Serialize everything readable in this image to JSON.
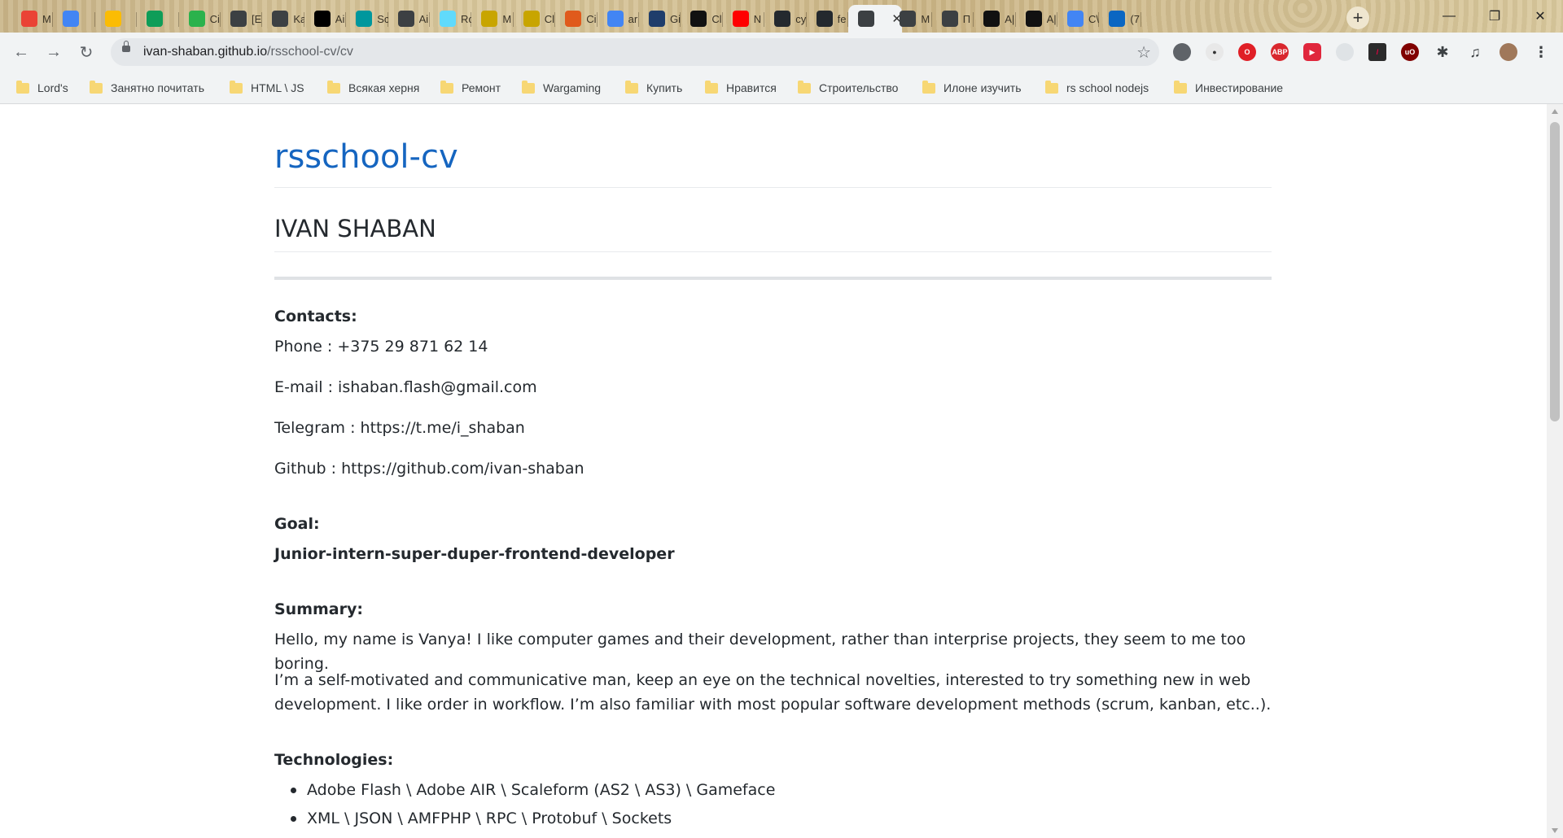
{
  "browser": {
    "tabs": [
      {
        "title": "M",
        "icon": "gmail-icon",
        "color": "#ea4335"
      },
      {
        "title": "",
        "icon": "google-translate-icon",
        "color": "#4285f4"
      },
      {
        "title": "",
        "icon": "google-keep-icon",
        "color": "#fbbc04"
      },
      {
        "title": "",
        "icon": "google-sheets-add-icon",
        "color": "#0f9d58"
      },
      {
        "title": "Ci",
        "icon": "feedly-icon",
        "color": "#2bb24c"
      },
      {
        "title": "[E",
        "icon": "globe-icon",
        "color": "#3c4043"
      },
      {
        "title": "Ka",
        "icon": "globe-icon",
        "color": "#3c4043"
      },
      {
        "title": "Ai",
        "icon": "jetbrains-icon",
        "color": "#000000"
      },
      {
        "title": "Sc",
        "icon": "arduino-icon",
        "color": "#00979d"
      },
      {
        "title": "Ai",
        "icon": "globe-icon",
        "color": "#3c4043"
      },
      {
        "title": "Rc",
        "icon": "react-icon",
        "color": "#61dafb"
      },
      {
        "title": "M",
        "icon": "metamask-icon",
        "color": "#c8a500"
      },
      {
        "title": "Cl",
        "icon": "metamask-icon",
        "color": "#c8a500"
      },
      {
        "title": "Ci",
        "icon": "codepen-icon",
        "color": "#e05a1c"
      },
      {
        "title": "ar",
        "icon": "google-icon",
        "color": "#4285f4"
      },
      {
        "title": "Gi",
        "icon": "r-icon",
        "color": "#1f3d6b"
      },
      {
        "title": "Cl",
        "icon": "notion-icon",
        "color": "#111111"
      },
      {
        "title": "N",
        "icon": "youtube-icon",
        "color": "#ff0000"
      },
      {
        "title": "cy",
        "icon": "github-icon",
        "color": "#24292e"
      },
      {
        "title": "fe",
        "icon": "github-icon",
        "color": "#24292e"
      },
      {
        "title": "",
        "icon": "globe-icon",
        "color": "#3c4043",
        "active": true
      },
      {
        "title": "M",
        "icon": "globe-icon",
        "color": "#3c4043"
      },
      {
        "title": "П",
        "icon": "globe-icon",
        "color": "#3c4043"
      },
      {
        "title": "A|",
        "icon": "rs-school-icon",
        "color": "#111111"
      },
      {
        "title": "A|",
        "icon": "rs-school-icon",
        "color": "#111111"
      },
      {
        "title": "C\\",
        "icon": "google-docs-icon",
        "color": "#4285f4"
      },
      {
        "title": "(7",
        "icon": "linkedin-icon",
        "color": "#0a66c2"
      }
    ],
    "url_host": "ivan-shaban.github.io",
    "url_path": "/rsschool-cv/cv",
    "bookmarks": [
      "Lord's",
      "Занятно почитать",
      "HTML \\ JS",
      "Всякая херня",
      "Ремонт",
      "Wargaming",
      "Купить",
      "Нравится",
      "Строительство",
      "Илоне изучить",
      "rs school nodejs",
      "Инвестирование"
    ]
  },
  "cv": {
    "site_title": "rsschool-cv",
    "name": "IVAN SHABAN",
    "contacts_heading": "Contacts:",
    "phone": "Phone : +375 29 871 62 14",
    "email": "E-mail : ishaban.flash@gmail.com",
    "telegram": "Telegram : https://t.me/i_shaban",
    "github": "Github : https://github.com/ivan-shaban",
    "goal_heading": "Goal:",
    "goal": "Junior-intern-super-duper-frontend-developer",
    "summary_heading": "Summary:",
    "summary_1": "Hello, my name is Vanya! I like computer games and their development, rather than interprise projects, they seem to me too boring.",
    "summary_2a": "I’m a self-motivated and communicative man, keep an eye on the technical novelties, interested to try something new in web",
    "summary_2b": "development. I like order in workflow. I’m also familiar with most popular software development methods (scrum, kanban, etc..).",
    "technologies_heading": "Technologies:",
    "technologies": [
      "Adobe Flash \\ Adobe AIR \\ Scaleform (AS2 \\ AS3) \\ Gameface",
      "XML \\ JSON \\ AMFPHP \\ RPC \\ Protobuf \\ Sockets"
    ]
  }
}
